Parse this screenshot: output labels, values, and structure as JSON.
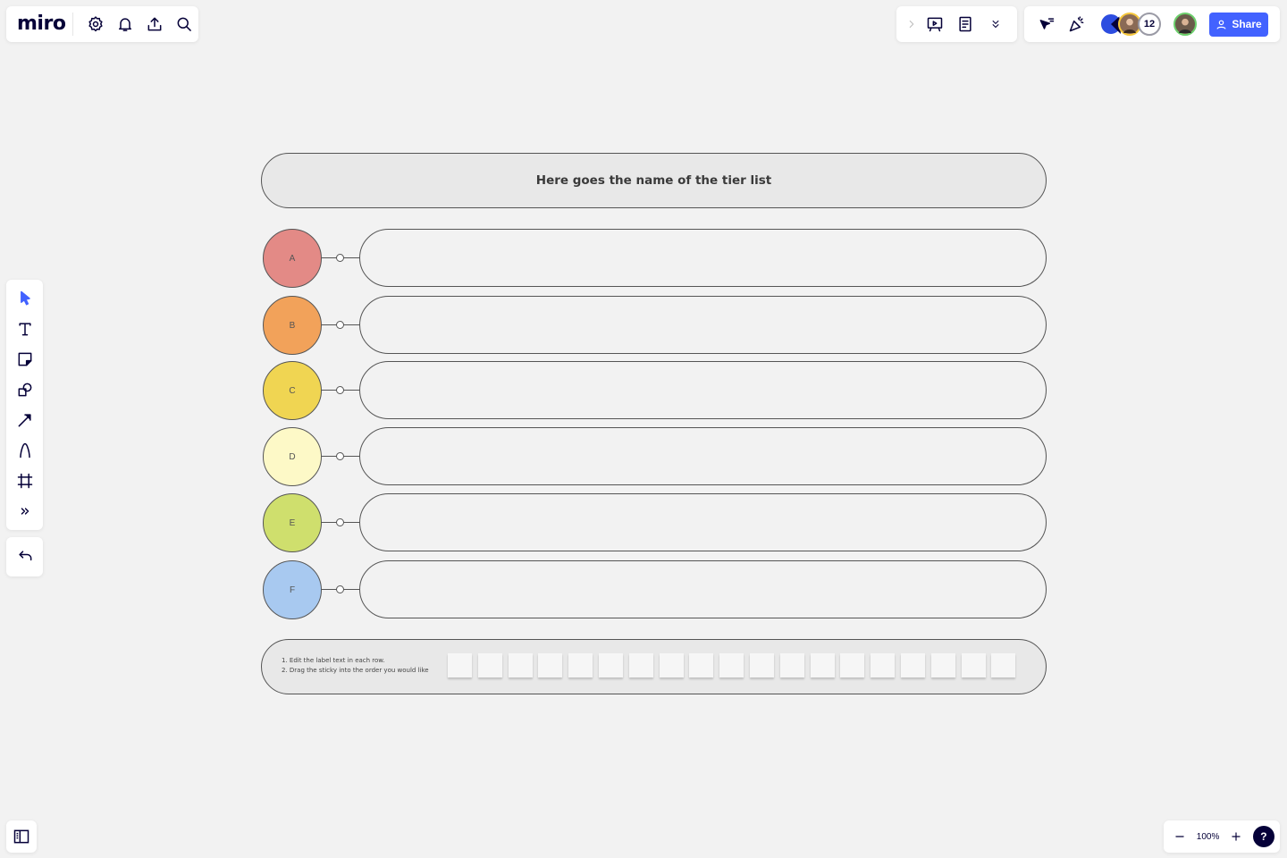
{
  "app": {
    "logo": "miro"
  },
  "top_left_icons": [
    "settings-icon",
    "notifications-icon",
    "export-icon",
    "search-icon"
  ],
  "top_mid_icons": [
    "expand-chevron-icon",
    "presentation-icon",
    "notes-icon",
    "more-chevron-icon"
  ],
  "collaboration": {
    "icons": [
      "cursor-follow-icon",
      "celebrate-icon"
    ],
    "avatars_extra_count": "12",
    "share_label": "Share"
  },
  "toolbar": {
    "tools": [
      "select",
      "text",
      "sticky-note",
      "shapes",
      "connection-line",
      "pen",
      "frame",
      "more-tools"
    ],
    "undo": "undo"
  },
  "zoom": {
    "level": "100%",
    "minus": "−",
    "plus": "+",
    "help": "?"
  },
  "board": {
    "title": "Here goes the name of the tier list",
    "tiers": [
      {
        "label": "A",
        "color": "#e38a86"
      },
      {
        "label": "B",
        "color": "#f2a25a"
      },
      {
        "label": "C",
        "color": "#f0d552"
      },
      {
        "label": "D",
        "color": "#fdf9c7"
      },
      {
        "label": "E",
        "color": "#cfdf6d"
      },
      {
        "label": "F",
        "color": "#a8c9f0"
      }
    ],
    "instructions": [
      "1. Edit the label text in each row.",
      "2. Drag the sticky into the order you would like"
    ],
    "sticky_count": 19
  },
  "colors": {
    "accent": "#4262ff",
    "ink": "#050038"
  }
}
